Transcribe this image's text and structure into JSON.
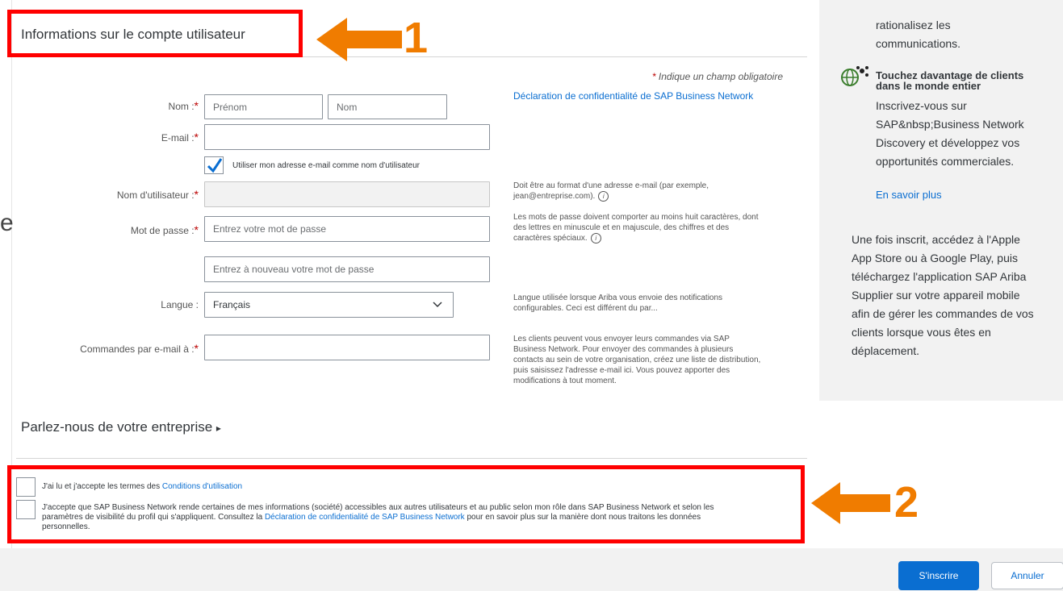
{
  "left_fragment": "e",
  "section": {
    "title": "Informations sur le compte utilisateur",
    "required_star": "*",
    "required_note": "Indique un champ obligatoire",
    "privacy_link": "Déclaration de confidentialité de SAP Business Network"
  },
  "form": {
    "name": {
      "label": "Nom :",
      "first_placeholder": "Prénom",
      "last_placeholder": "Nom"
    },
    "email": {
      "label": "E-mail :",
      "value": ""
    },
    "use_email_checkbox": {
      "checked": true,
      "label": "Utiliser mon adresse e-mail comme nom d'utilisateur"
    },
    "username": {
      "label": "Nom d'utilisateur :",
      "help_line1": "Doit être au format d'une adresse e-mail (par exemple,",
      "help_line2": "jean@entreprise.com)."
    },
    "password": {
      "label": "Mot de passe :",
      "placeholder": "Entrez votre mot de passe",
      "confirm_placeholder": "Entrez à nouveau votre mot de passe",
      "help_line1": "Les mots de passe doivent comporter au moins huit caractères, dont",
      "help_line2": "des lettres en minuscule et en majuscule, des chiffres et des",
      "help_line3": "caractères spéciaux."
    },
    "language": {
      "label": "Langue :",
      "selected": "Français",
      "help_line1": "Langue utilisée lorsque Ariba vous envoie des notifications",
      "help_line2": "configurables. Ceci est différent du par..."
    },
    "orders_email": {
      "label": "Commandes par e-mail à :",
      "help_line1": "Les clients peuvent vous envoyer leurs commandes via SAP",
      "help_line2": "Business Network. Pour envoyer des commandes à plusieurs",
      "help_line3": "contacts au sein de votre organisation, créez une liste de distribution,",
      "help_line4": "puis saisissez l'adresse e-mail ici. Vous pouvez apporter des",
      "help_line5": "modifications à tout moment."
    }
  },
  "company": {
    "heading": "Parlez-nous de votre entreprise",
    "arrow": "▸"
  },
  "terms": {
    "t1_prefix": "J'ai lu et j'accepte les termes des ",
    "t1_link": "Conditions d'utilisation",
    "t2_line1": "J'accepte que SAP Business Network rende certaines de mes informations (société) accessibles aux autres utilisateurs et au public selon mon rôle dans SAP Business Network et selon les",
    "t2_line2_prefix": "paramètres de visibilité du profil qui s'appliquent. Consultez la ",
    "t2_link": "Déclaration de confidentialité de SAP Business Network",
    "t2_line2_suffix": " pour en savoir plus sur la manière dont nous traitons les données",
    "t2_line3": "personnelles."
  },
  "buttons": {
    "register": "S'inscrire",
    "cancel": "Annuler"
  },
  "right_panel": {
    "top_line1": "rationalisez les",
    "top_line2": "communications.",
    "title_line1": "Touchez davantage de clients",
    "title_line2": "dans le monde entier",
    "body_line1": "Inscrivez-vous sur",
    "body_line2": "SAP&nbsp;Business Network",
    "body_line3": "Discovery et développez vos",
    "body_line4": "opportunités commerciales.",
    "learn_more": "En savoir plus",
    "app_line1": "Une fois inscrit, accédez à l'Apple",
    "app_line2": "App Store ou à Google Play, puis",
    "app_line3": "téléchargez l'application SAP Ariba",
    "app_line4": "Supplier sur votre appareil mobile",
    "app_line5": "afin de gérer les commandes de vos",
    "app_line6": "clients lorsque vous êtes en",
    "app_line7": "déplacement."
  },
  "annotations": {
    "label1": "1",
    "label2": "2",
    "color": "#f07c00",
    "box_color": "#ff0000"
  },
  "colors": {
    "primary": "#0a6ed1",
    "required": "#bb0000"
  }
}
